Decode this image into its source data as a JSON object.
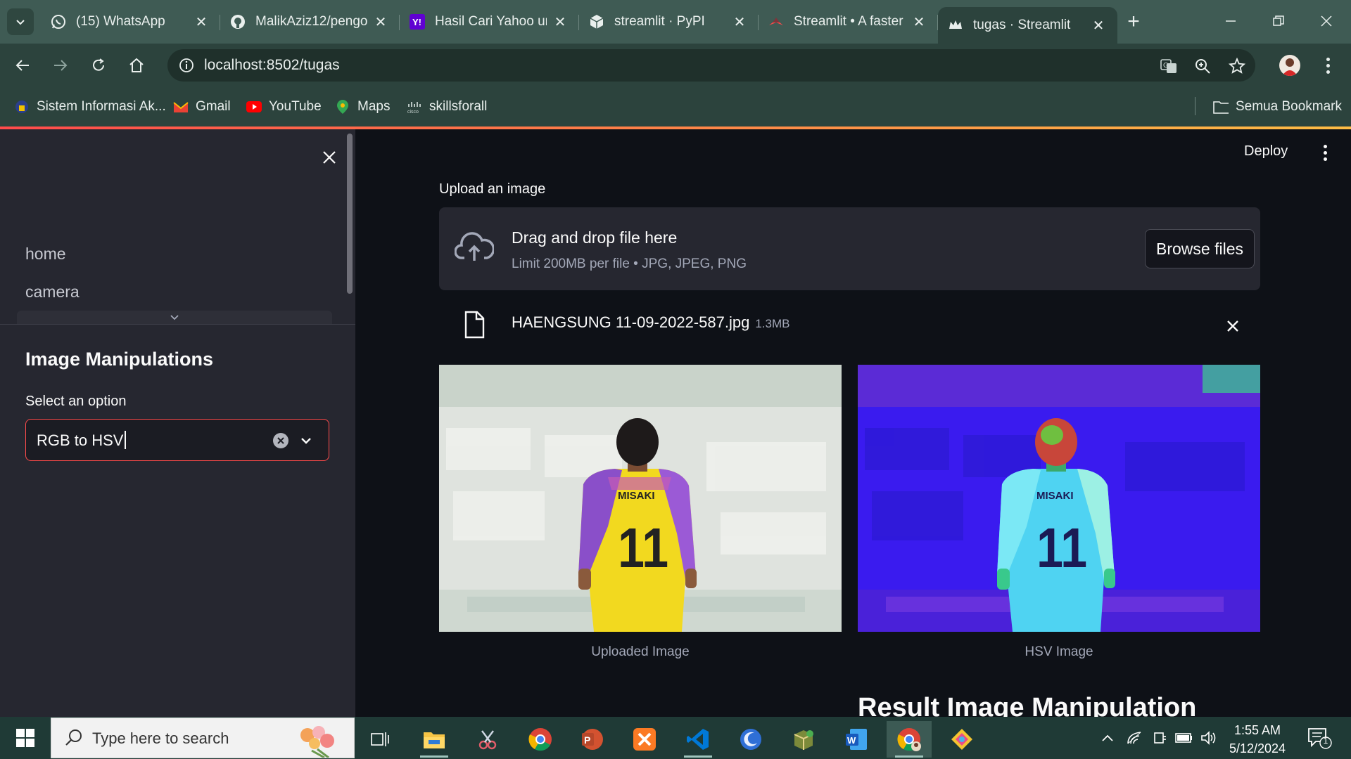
{
  "browser": {
    "tabs": [
      {
        "title": "(15) WhatsApp",
        "icon": "whatsapp-icon",
        "active": false
      },
      {
        "title": "MalikAziz12/pengo",
        "icon": "github-icon",
        "active": false
      },
      {
        "title": "Hasil Cari Yahoo ur",
        "icon": "yahoo-icon",
        "active": false
      },
      {
        "title": "streamlit · PyPI",
        "icon": "pypi-icon",
        "active": false
      },
      {
        "title": "Streamlit • A faster",
        "icon": "streamlit-icon",
        "active": false
      },
      {
        "title": "tugas · Streamlit",
        "icon": "streamlit-crown-icon",
        "active": true
      }
    ],
    "url": "localhost:8502/tugas",
    "bookmarks": [
      {
        "label": "Sistem Informasi Ak...",
        "icon": "university-icon"
      },
      {
        "label": "Gmail",
        "icon": "gmail-icon"
      },
      {
        "label": "YouTube",
        "icon": "youtube-icon"
      },
      {
        "label": "Maps",
        "icon": "maps-icon"
      },
      {
        "label": "skillsforall",
        "icon": "cisco-icon"
      }
    ],
    "all_bookmarks_label": "Semua Bookmark"
  },
  "sidebar": {
    "nav": [
      {
        "label": "home"
      },
      {
        "label": "camera"
      }
    ],
    "heading": "Image Manipulations",
    "select_label": "Select an option",
    "select_value": "RGB to HSV"
  },
  "main": {
    "deploy_label": "Deploy",
    "upload_label": "Upload an image",
    "dropzone_title": "Drag and drop file here",
    "dropzone_limit": "Limit 200MB per file • JPG, JPEG, PNG",
    "browse_label": "Browse files",
    "file": {
      "name": "HAENGSUNG 11-09-2022-587.jpg",
      "size": "1.3MB"
    },
    "images": [
      {
        "caption": "Uploaded Image",
        "jersey_name": "MISAKI",
        "jersey_number": "11"
      },
      {
        "caption": "HSV Image",
        "jersey_name": "MISAKI",
        "jersey_number": "11"
      }
    ],
    "result_title": "Result Image Manipulation"
  },
  "taskbar": {
    "search_placeholder": "Type here to search",
    "time": "1:55 AM",
    "date": "5/12/2024",
    "notification_count": "1"
  },
  "colors": {
    "accent": "#ff4b4b",
    "chrome_frame": "#3f5b54",
    "chrome_toolbar": "#2c433d",
    "sidebar_bg": "#262730",
    "main_bg": "#0e1117"
  }
}
